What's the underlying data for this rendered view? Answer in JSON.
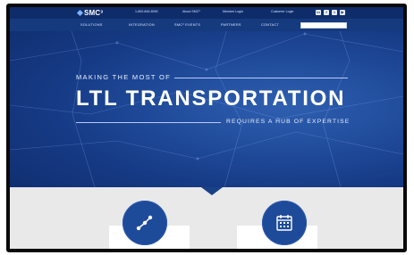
{
  "brand": {
    "name": "SMC³"
  },
  "top_links": [
    "1-800-845-8090",
    "About SMC³",
    "Member Login",
    "Customer Login"
  ],
  "social_icons": [
    "linkedin-icon",
    "facebook-icon",
    "twitter-icon",
    "youtube-icon"
  ],
  "nav": [
    "SOLUTIONS",
    "INTEGRATION",
    "SMC³ EVENTS",
    "PARTNERS",
    "CONTACT"
  ],
  "search": {
    "placeholder": ""
  },
  "hero": {
    "line1": "MAKING THE MOST OF",
    "line2": "LTL TRANSPORTATION",
    "line3": "REQUIRES A HUB OF EXPERTISE"
  },
  "feature_icons": [
    "network-nodes-icon",
    "calendar-icon"
  ]
}
